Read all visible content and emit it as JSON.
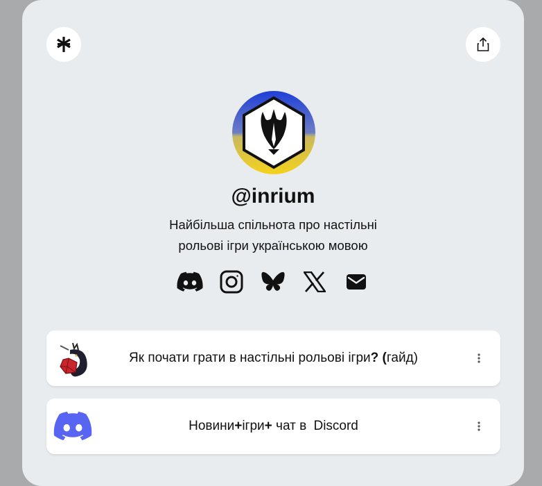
{
  "profile": {
    "handle": "@inrium",
    "bio_line1": "Найбільша спільнота про настільні",
    "bio_line2": "рольові ігри українською мовою"
  },
  "header": {
    "logo_icon": "linktree-asterisk-icon",
    "share_icon": "share-icon"
  },
  "socials": [
    {
      "icon": "discord-icon"
    },
    {
      "icon": "instagram-icon"
    },
    {
      "icon": "bluesky-icon"
    },
    {
      "icon": "x-icon"
    },
    {
      "icon": "email-icon"
    }
  ],
  "links": [
    {
      "label_before": "Як почати грати в настільні рольові ігри",
      "label_bold": "? (",
      "label_after": "гайд)",
      "thumb": "dragon-dice-icon"
    },
    {
      "label_before": "Новини ",
      "plus1": "+",
      "label_mid": " ігри ",
      "plus2": "+",
      "label_after": " чат в ",
      "label_bold": "Discord",
      "thumb": "discord-icon"
    }
  ],
  "colors": {
    "background": "#a8aaac",
    "card": "#e9ecef",
    "discord_brand": "#5865f2",
    "flag_blue": "#1f3fd8",
    "flag_yellow": "#f4d21a"
  }
}
